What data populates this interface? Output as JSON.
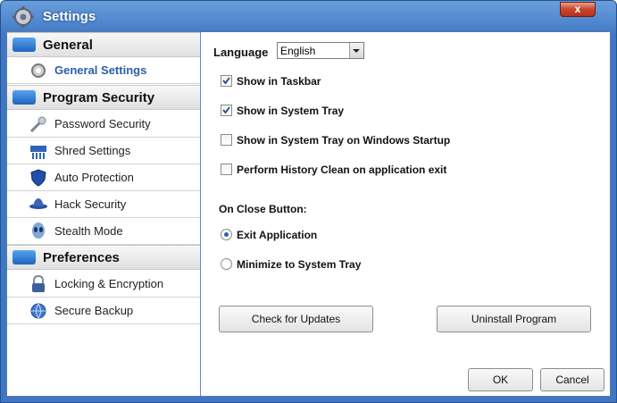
{
  "window": {
    "title": "Settings",
    "close_label": "x"
  },
  "sidebar": {
    "categories": [
      {
        "label": "General",
        "items": [
          {
            "label": "General Settings",
            "active": true
          }
        ]
      },
      {
        "label": "Program Security",
        "items": [
          {
            "label": "Password Security"
          },
          {
            "label": "Shred Settings"
          },
          {
            "label": "Auto Protection"
          },
          {
            "label": "Hack Security"
          },
          {
            "label": "Stealth Mode"
          }
        ]
      },
      {
        "label": "Preferences",
        "items": [
          {
            "label": "Locking & Encryption"
          },
          {
            "label": "Secure Backup"
          }
        ]
      }
    ]
  },
  "settings": {
    "language_label": "Language",
    "language_value": "English",
    "options": [
      {
        "label": "Show in Taskbar",
        "checked": true
      },
      {
        "label": "Show in System Tray",
        "checked": true
      },
      {
        "label": "Show in System Tray on Windows Startup",
        "checked": false
      },
      {
        "label": "Perform History Clean on application exit",
        "checked": false
      }
    ],
    "close_button_label": "On Close Button:",
    "close_options": [
      {
        "label": "Exit Application",
        "selected": true
      },
      {
        "label": "Minimize to System Tray",
        "selected": false
      }
    ]
  },
  "buttons": {
    "check_updates": "Check for Updates",
    "uninstall": "Uninstall Program",
    "ok": "OK",
    "cancel": "Cancel"
  },
  "colors": {
    "accent": "#3f77c4",
    "active_item": "#2c5ea8"
  }
}
